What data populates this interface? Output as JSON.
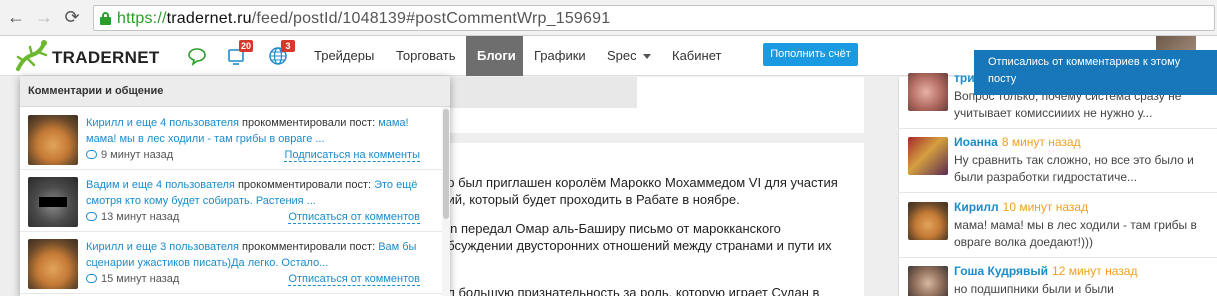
{
  "browser": {
    "back": "←",
    "forward": "→",
    "reload": "⟳",
    "url_proto": "https://",
    "url_host": "tradernet.ru",
    "url_path": "/feed/postId/1048139#postCommentWrp_159691"
  },
  "nav": {
    "logo": "TRADERNET",
    "badge_notifications": "20",
    "badge_globe": "3",
    "links": [
      {
        "label": "Трейдеры"
      },
      {
        "label": "Торговать"
      },
      {
        "label": "Блоги"
      },
      {
        "label": "Графики"
      },
      {
        "label": "Spec"
      },
      {
        "label": "Кабинет"
      }
    ],
    "topup": "Пополнить счёт"
  },
  "tooltip": "Отписались от комментариев к этому посту",
  "dropdown": {
    "title": "Комментарии и общение",
    "items": [
      {
        "users": "Кирилл и еще 4 пользователя",
        "verb": " прокомментировали пост: ",
        "post": "мама! мама! мы в лес ходили - там грибы в овраге ...",
        "time": "9 минут назад",
        "action": "Подписаться на комменты"
      },
      {
        "users": "Вадим и еще 4 пользователя",
        "verb": " прокомментировали пост: ",
        "post": "Это ещё смотря кто кому будет собирать. Растения ...",
        "time": "13 минут назад",
        "action": "Отписаться от комментов"
      },
      {
        "users": "Кирилл и еще 3 пользователя",
        "verb": " прокомментировали пост: ",
        "post": "Вам бы сценарии ужастиков писать)Да легко. Остало...",
        "time": "15 минут назад",
        "action": "Отписаться от комментов"
      }
    ]
  },
  "article": {
    "lines": [
      "ар был приглашен королём Марокко Мохаммедом VI для участия",
      "ций, который будет проходить в Рабате в ноябре.",
      "ain передал Омар аль-Баширу письмо от марокканского",
      "обсуждении двусторонних отношений между странами и пути их",
      "ил большую признательность за роль, которую играет Судан в"
    ]
  },
  "feed": [
    {
      "name": "три",
      "time": "",
      "text": "Вопрос только, почему система сразу не учитывает комиссииих не нужно у..."
    },
    {
      "name": "Иоанна",
      "time": "8 минут назад",
      "text": "Ну сравнить так сложно, но все это было и были разработки гидростатиче..."
    },
    {
      "name": "Кирилл",
      "time": "10 минут назад",
      "text": "мама! мама! мы в лес ходили - там грибы в овраге волка доедают!)))"
    },
    {
      "name": "Гоша Кудрявый",
      "time": "12 минут назад",
      "text": "но подшипники были и были"
    }
  ]
}
